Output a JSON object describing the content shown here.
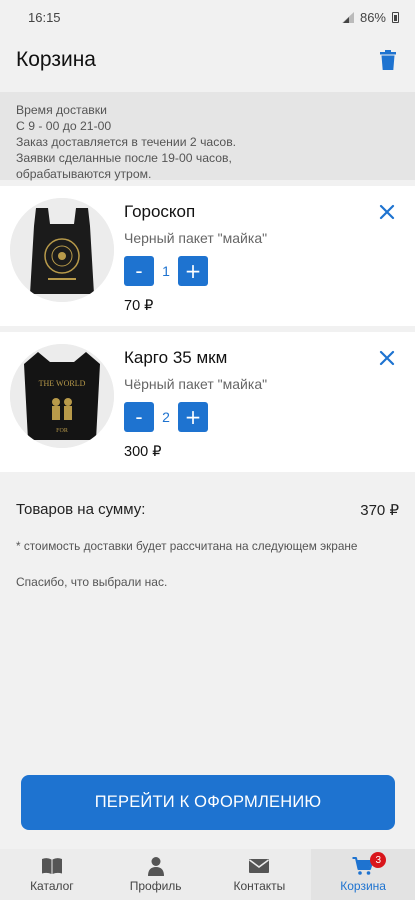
{
  "status_bar": {
    "time": "16:15",
    "battery": "86%"
  },
  "header": {
    "title": "Корзина"
  },
  "delivery_info": {
    "lines": [
      "Время доставки",
      "С 9 - 00 до 21-00",
      "Заказ доставляется в течении 2 часов.",
      "Заявки сделанные после 19-00 часов,",
      "обрабатываются утром."
    ]
  },
  "cart": {
    "items": [
      {
        "name": "Гороскоп",
        "description": "Черный пакет \"майка\"",
        "quantity": "1",
        "price": "70 ₽"
      },
      {
        "name": "Карго 35 мкм",
        "description": "Чёрный пакет \"майка\"",
        "quantity": "2",
        "price": "300 ₽"
      }
    ],
    "minus_label": "-",
    "plus_label": "+"
  },
  "summary": {
    "label": "Товаров на сумму:",
    "total": "370 ₽",
    "note": "* стоимость доставки будет рассчитана на следующем экране",
    "thanks": "Спасибо, что выбрали нас."
  },
  "checkout": {
    "label": "ПЕРЕЙТИ К ОФОРМЛЕНИЮ"
  },
  "tabs": [
    {
      "label": "Каталог",
      "icon": "book-icon"
    },
    {
      "label": "Профиль",
      "icon": "user-icon"
    },
    {
      "label": "Контакты",
      "icon": "mail-icon"
    },
    {
      "label": "Корзина",
      "icon": "cart-icon",
      "badge": "3"
    }
  ],
  "colors": {
    "accent": "#1e73d0",
    "badge": "#d9161c"
  }
}
